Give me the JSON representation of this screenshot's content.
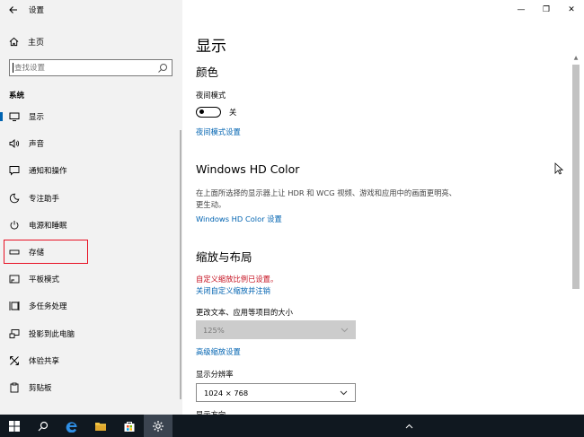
{
  "window": {
    "app_title": "设置",
    "controls": {
      "minimize": "—",
      "maximize": "❐",
      "close": "✕"
    }
  },
  "sidebar": {
    "home_label": "主页",
    "search_placeholder": "查找设置",
    "section_title": "系统",
    "items": [
      {
        "label": "显示",
        "icon": "display-icon",
        "active": true
      },
      {
        "label": "声音",
        "icon": "speaker-icon"
      },
      {
        "label": "通知和操作",
        "icon": "notification-icon"
      },
      {
        "label": "专注助手",
        "icon": "moon-icon"
      },
      {
        "label": "电源和睡眠",
        "icon": "power-icon"
      },
      {
        "label": "存储",
        "icon": "storage-icon",
        "highlighted": true
      },
      {
        "label": "平板模式",
        "icon": "tablet-icon"
      },
      {
        "label": "多任务处理",
        "icon": "multitask-icon"
      },
      {
        "label": "投影到此电脑",
        "icon": "project-icon"
      },
      {
        "label": "体验共享",
        "icon": "shared-experience-icon"
      },
      {
        "label": "剪贴板",
        "icon": "clipboard-icon"
      }
    ]
  },
  "main": {
    "page_title": "显示",
    "color": {
      "heading": "颜色",
      "night_light_label": "夜间模式",
      "toggle_state": "关",
      "night_light_settings_link": "夜间模式设置"
    },
    "hdr": {
      "heading": "Windows HD Color",
      "description": "在上面所选择的显示器上让 HDR 和 WCG 视频、游戏和应用中的画面更明亮、更生动。",
      "settings_link": "Windows HD Color 设置"
    },
    "scale": {
      "heading": "缩放与布局",
      "warning": "自定义缩放比例已设置。",
      "disable_link": "关闭自定义缩放并注销",
      "size_label": "更改文本、应用等项目的大小",
      "size_value": "125%",
      "advanced_link": "高级缩放设置",
      "resolution_label": "显示分辨率",
      "resolution_value": "1024 × 768",
      "orientation_label": "显示方向"
    }
  },
  "taskbar": {
    "items": [
      "windows-start-icon",
      "search-icon",
      "edge-icon",
      "file-explorer-icon",
      "store-icon",
      "settings-icon"
    ],
    "active": "settings-icon"
  },
  "colors": {
    "accent": "#0063b1",
    "warning": "#c50f1f",
    "highlight_box": "#e81123",
    "taskbar": "#101820"
  }
}
